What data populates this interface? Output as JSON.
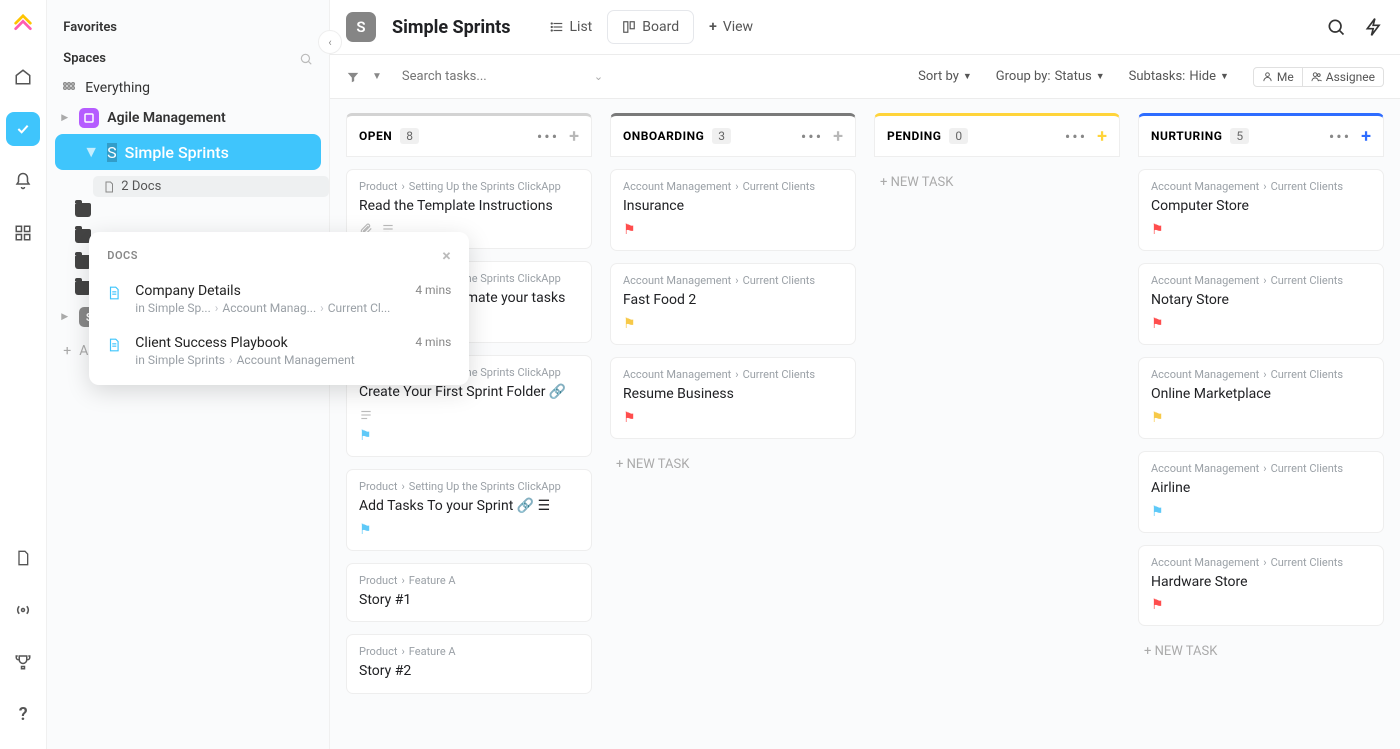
{
  "sidebar": {
    "favorites_label": "Favorites",
    "spaces_label": "Spaces",
    "everything_label": "Everything",
    "agile_label": "Agile Management",
    "simple_sprints_label": "Simple Sprints",
    "docs_badge": "2 Docs",
    "folders": [
      "",
      "",
      "",
      ""
    ],
    "space_label": "Space",
    "add_space_label": "Add Space"
  },
  "docs_popup": {
    "heading": "DOCS",
    "items": [
      {
        "title": "Company Details",
        "time": "4 mins",
        "crumbs": [
          "in Simple Sp...",
          "Account Manag...",
          "Current Cl..."
        ]
      },
      {
        "title": "Client Success Playbook",
        "time": "4 mins",
        "crumbs": [
          "in Simple Sprints",
          "Account Management"
        ]
      }
    ]
  },
  "header": {
    "space_initial": "S",
    "title": "Simple Sprints",
    "views": {
      "list": "List",
      "board": "Board",
      "add": "View"
    }
  },
  "filters": {
    "search_placeholder": "Search tasks...",
    "sort": "Sort by",
    "group": "Group by:",
    "group_value": "Status",
    "subtasks": "Subtasks:",
    "subtasks_value": "Hide",
    "me": "Me",
    "assignee": "Assignee"
  },
  "columns": [
    {
      "id": "open",
      "name": "OPEN",
      "count": "8",
      "topColor": "#d3d3d3",
      "addColor": "#b8b8b8",
      "cards": [
        {
          "crumbs": [
            "Product",
            "Setting Up the Sprints ClickApp"
          ],
          "title": "Read the Template Instructions",
          "icons": [
            "clip",
            "list"
          ]
        },
        {
          "crumbs": [
            "Product",
            "Setting Up the Sprints ClickApp"
          ],
          "title": "Learn how to estimate your tasks",
          "flagColor": "#f7c948"
        },
        {
          "crumbs": [
            "Product",
            "Setting Up the Sprints ClickApp"
          ],
          "title": "Create Your First Sprint Folder 🔗",
          "icons": [
            "list"
          ],
          "flagColor": "#5ec9f8"
        },
        {
          "crumbs": [
            "Product",
            "Setting Up the Sprints ClickApp"
          ],
          "title": "Add Tasks To your Sprint 🔗 ☰",
          "flagColor": "#5ec9f8"
        },
        {
          "crumbs": [
            "Product",
            "Feature A"
          ],
          "title": "Story #1"
        },
        {
          "crumbs": [
            "Product",
            "Feature A"
          ],
          "title": "Story #2"
        }
      ]
    },
    {
      "id": "onboarding",
      "name": "ONBOARDING",
      "count": "3",
      "topColor": "#7a7a7a",
      "addColor": "#b8b8b8",
      "cards": [
        {
          "crumbs": [
            "Account Management",
            "Current Clients"
          ],
          "title": "Insurance",
          "flagColor": "#ff4d4d"
        },
        {
          "crumbs": [
            "Account Management",
            "Current Clients"
          ],
          "title": "Fast Food 2",
          "flagColor": "#f7c948"
        },
        {
          "crumbs": [
            "Account Management",
            "Current Clients"
          ],
          "title": "Resume Business",
          "flagColor": "#ff4d4d"
        }
      ],
      "newTask": "+ NEW TASK"
    },
    {
      "id": "pending",
      "name": "PENDING",
      "count": "0",
      "topColor": "#ffd43a",
      "addColor": "#ffd43a",
      "cards": [],
      "newTask": "+ NEW TASK"
    },
    {
      "id": "nurturing",
      "name": "NURTURING",
      "count": "5",
      "topColor": "#2e6cff",
      "addColor": "#2e6cff",
      "cards": [
        {
          "crumbs": [
            "Account Management",
            "Current Clients"
          ],
          "title": "Computer Store",
          "flagColor": "#ff4d4d"
        },
        {
          "crumbs": [
            "Account Management",
            "Current Clients"
          ],
          "title": "Notary Store",
          "flagColor": "#ff4d4d"
        },
        {
          "crumbs": [
            "Account Management",
            "Current Clients"
          ],
          "title": "Online Marketplace",
          "flagColor": "#f7c948"
        },
        {
          "crumbs": [
            "Account Management",
            "Current Clients"
          ],
          "title": "Airline",
          "flagColor": "#5ec9f8"
        },
        {
          "crumbs": [
            "Account Management",
            "Current Clients"
          ],
          "title": "Hardware Store",
          "flagColor": "#ff4d4d"
        }
      ],
      "newTask": "+ NEW TASK"
    }
  ]
}
